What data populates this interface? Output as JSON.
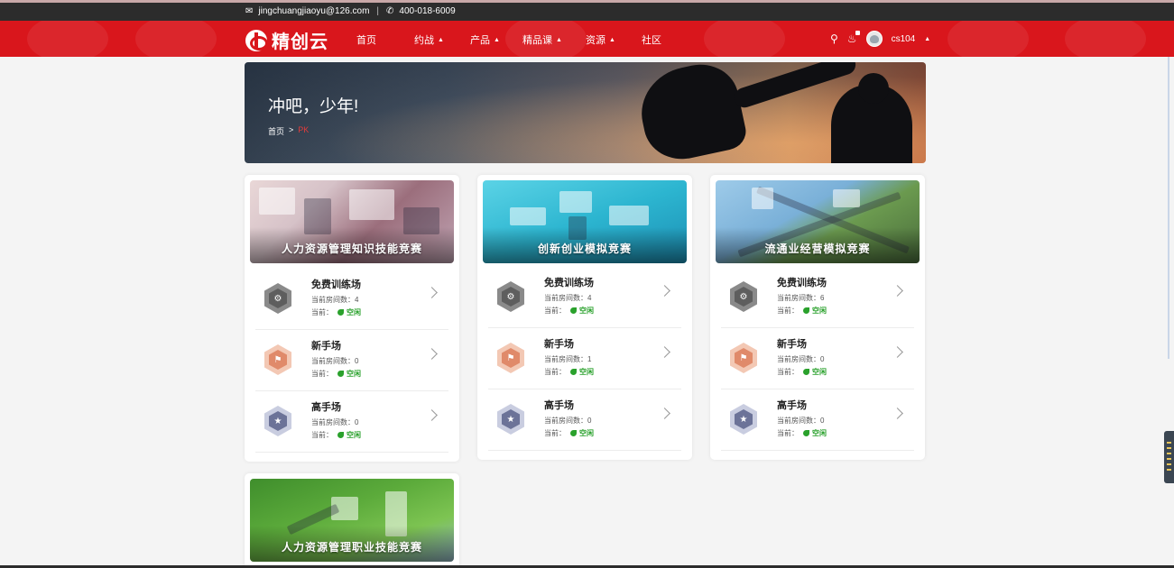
{
  "topbar": {
    "email": "jingchuangjiaoyu@126.com",
    "separator": "|",
    "phone": "400-018-6009"
  },
  "navbar": {
    "brand": "精创云",
    "items": [
      {
        "label": "首页",
        "has_caret": false
      },
      {
        "label": "约战",
        "has_caret": true
      },
      {
        "label": "产品",
        "has_caret": true
      },
      {
        "label": "精品课",
        "has_caret": true
      },
      {
        "label": "资源",
        "has_caret": true
      },
      {
        "label": "社区",
        "has_caret": false
      }
    ],
    "username": "cs104",
    "caret": "▲"
  },
  "hero": {
    "title": "冲吧，少年!",
    "breadcrumb_home": "首页",
    "breadcrumb_sep": ">",
    "breadcrumb_current": "PK"
  },
  "cards": [
    {
      "title": "人力资源管理知识技能竞赛",
      "rows": [
        {
          "name": "免费训练场",
          "rooms_label": "当前房间数：",
          "rooms": "4",
          "status_label": "当前：",
          "status": "空闲"
        },
        {
          "name": "新手场",
          "rooms_label": "当前房间数：",
          "rooms": "0",
          "status_label": "当前：",
          "status": "空闲"
        },
        {
          "name": "高手场",
          "rooms_label": "当前房间数：",
          "rooms": "0",
          "status_label": "当前：",
          "status": "空闲"
        }
      ]
    },
    {
      "title": "创新创业模拟竞赛",
      "rows": [
        {
          "name": "免费训练场",
          "rooms_label": "当前房间数：",
          "rooms": "4",
          "status_label": "当前：",
          "status": "空闲"
        },
        {
          "name": "新手场",
          "rooms_label": "当前房间数：",
          "rooms": "1",
          "status_label": "当前：",
          "status": "空闲"
        },
        {
          "name": "高手场",
          "rooms_label": "当前房间数：",
          "rooms": "0",
          "status_label": "当前：",
          "status": "空闲"
        }
      ]
    },
    {
      "title": "流通业经营模拟竞赛",
      "rows": [
        {
          "name": "免费训练场",
          "rooms_label": "当前房间数：",
          "rooms": "6",
          "status_label": "当前：",
          "status": "空闲"
        },
        {
          "name": "新手场",
          "rooms_label": "当前房间数：",
          "rooms": "0",
          "status_label": "当前：",
          "status": "空闲"
        },
        {
          "name": "高手场",
          "rooms_label": "当前房间数：",
          "rooms": "0",
          "status_label": "当前：",
          "status": "空闲"
        }
      ]
    },
    {
      "title": "人力资源管理职业技能竞赛",
      "rows": []
    }
  ],
  "colors": {
    "brand_red": "#d9161c",
    "status_green": "#2aa12c",
    "breadcrumb_current": "#e23b3b"
  },
  "icons": [
    "envelope-icon",
    "phone-icon",
    "search-icon",
    "bell-icon",
    "avatar",
    "chevron-right-icon"
  ]
}
